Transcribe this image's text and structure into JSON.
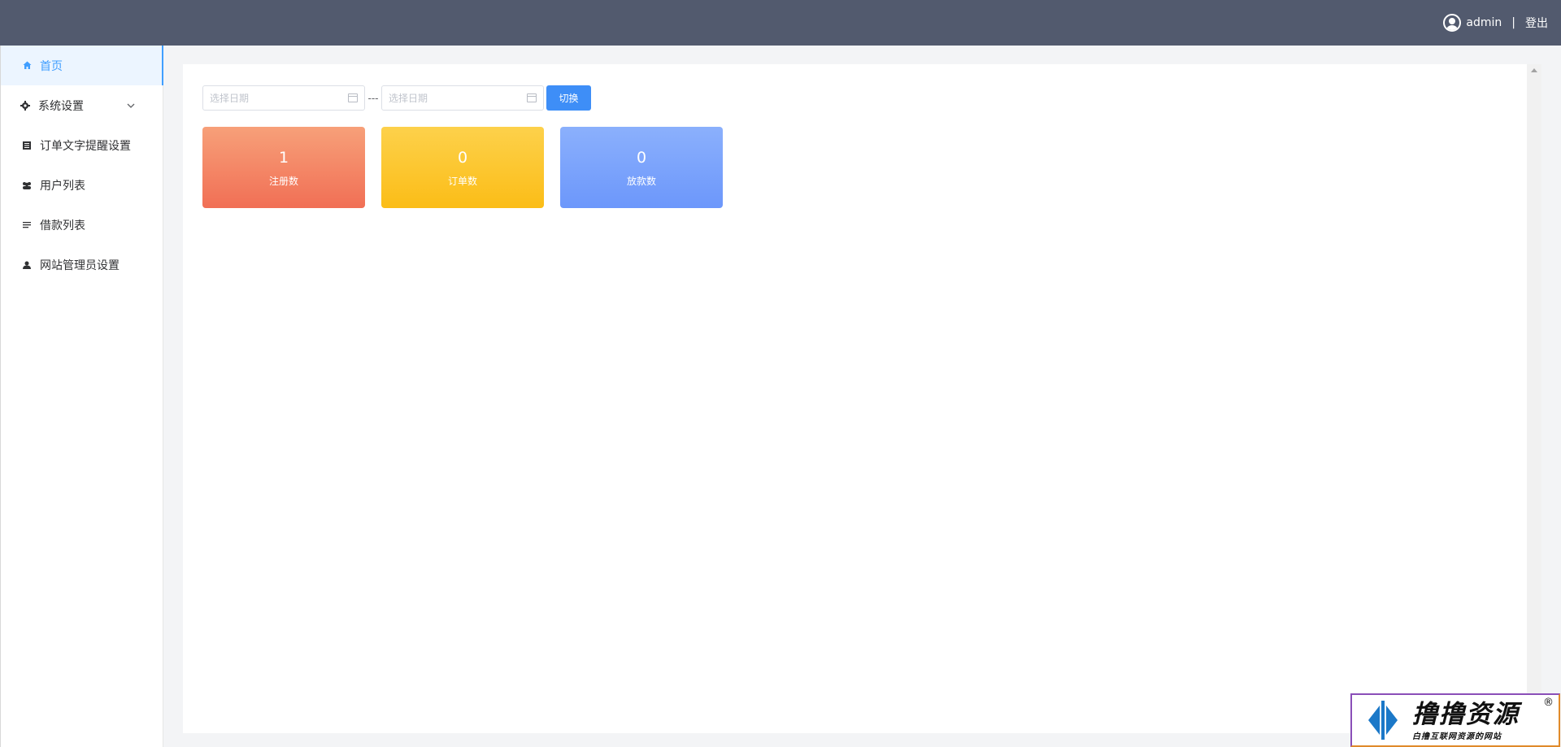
{
  "header": {
    "username": "admin",
    "separator": "|",
    "logout_label": "登出"
  },
  "sidebar": {
    "items": [
      {
        "label": "首页",
        "icon": "home-icon",
        "active": true
      },
      {
        "label": "系统设置",
        "icon": "gear-icon",
        "has_submenu": true
      },
      {
        "label": "订单文字提醒设置",
        "icon": "document-icon"
      },
      {
        "label": "用户列表",
        "icon": "users-icon"
      },
      {
        "label": "借款列表",
        "icon": "list-icon"
      },
      {
        "label": "网站管理员设置",
        "icon": "user-icon"
      }
    ]
  },
  "filter": {
    "start_placeholder": "选择日期",
    "end_placeholder": "选择日期",
    "dash": "---",
    "switch_label": "切换"
  },
  "stats": [
    {
      "value": "1",
      "label": "注册数",
      "color": "#f4855f"
    },
    {
      "value": "0",
      "label": "订单数",
      "color": "#fcc52c"
    },
    {
      "value": "0",
      "label": "放款数",
      "color": "#7ca2fb"
    }
  ],
  "watermark": {
    "title": "撸撸资源",
    "subtitle": "白撸互联网资源的网站",
    "registered": "®"
  },
  "colors": {
    "header_bg": "#525a6e",
    "accent": "#409eff",
    "button_bg": "#3e8ef7"
  }
}
